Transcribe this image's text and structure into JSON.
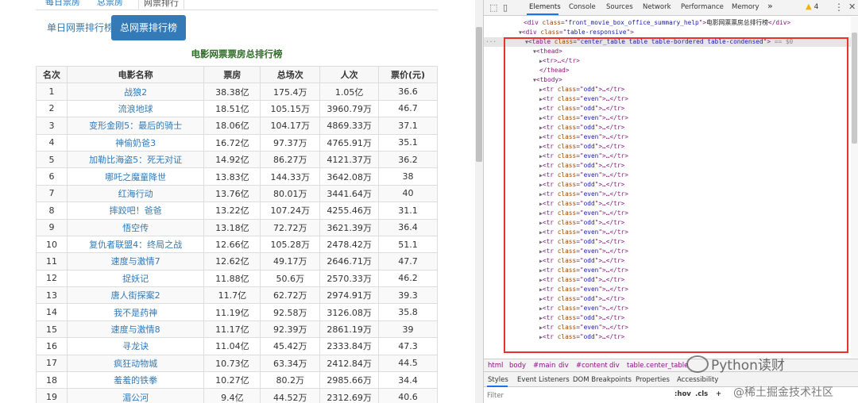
{
  "page": {
    "top_tabs": [
      "每日票房",
      "总票房",
      "网票排行"
    ],
    "sub_tabs": [
      {
        "label": "单日网票排行榜",
        "active": false
      },
      {
        "label": "总网票排行榜",
        "active": true
      }
    ],
    "table_title": "电影网票票房总排行榜",
    "columns": [
      "名次",
      "电影名称",
      "票房",
      "总场次",
      "人次",
      "票价(元)"
    ],
    "rows": [
      [
        "1",
        "战狼2",
        "38.38亿",
        "175.4万",
        "1.05亿",
        "36.6"
      ],
      [
        "2",
        "流浪地球",
        "18.51亿",
        "105.15万",
        "3960.79万",
        "46.7"
      ],
      [
        "3",
        "变形金刚5：最后的骑士",
        "18.06亿",
        "104.17万",
        "4869.33万",
        "37.1"
      ],
      [
        "4",
        "神偷奶爸3",
        "16.72亿",
        "97.37万",
        "4765.91万",
        "35.1"
      ],
      [
        "5",
        "加勒比海盗5：死无对证",
        "14.92亿",
        "86.27万",
        "4121.37万",
        "36.2"
      ],
      [
        "6",
        "哪吒之魔童降世",
        "13.83亿",
        "144.33万",
        "3642.08万",
        "38"
      ],
      [
        "7",
        "红海行动",
        "13.76亿",
        "80.01万",
        "3441.64万",
        "40"
      ],
      [
        "8",
        "摔跤吧！爸爸",
        "13.22亿",
        "107.24万",
        "4255.46万",
        "31.1"
      ],
      [
        "9",
        "悟空传",
        "13.18亿",
        "72.72万",
        "3621.39万",
        "36.4"
      ],
      [
        "10",
        "复仇者联盟4：终局之战",
        "12.66亿",
        "105.28万",
        "2478.42万",
        "51.1"
      ],
      [
        "11",
        "速度与激情7",
        "12.62亿",
        "49.17万",
        "2646.71万",
        "47.7"
      ],
      [
        "12",
        "捉妖记",
        "11.88亿",
        "50.6万",
        "2570.33万",
        "46.2"
      ],
      [
        "13",
        "唐人街探案2",
        "11.7亿",
        "62.72万",
        "2974.91万",
        "39.3"
      ],
      [
        "14",
        "我不是药神",
        "11.19亿",
        "92.58万",
        "3126.08万",
        "35.8"
      ],
      [
        "15",
        "速度与激情8",
        "11.17亿",
        "92.39万",
        "2861.19万",
        "39"
      ],
      [
        "16",
        "寻龙诀",
        "11.04亿",
        "45.42万",
        "2333.84万",
        "47.3"
      ],
      [
        "17",
        "疯狂动物城",
        "10.73亿",
        "63.34万",
        "2412.84万",
        "44.5"
      ],
      [
        "18",
        "羞羞的铁拳",
        "10.27亿",
        "80.2万",
        "2985.66万",
        "34.4"
      ],
      [
        "19",
        "湄公河",
        "9.4亿",
        "44.52万",
        "2312.69万",
        "40.6"
      ]
    ]
  },
  "devtools": {
    "tabs": [
      "Elements",
      "Console",
      "Sources",
      "Network",
      "Performance",
      "Memory"
    ],
    "more_tabs": "»",
    "warning_count": "4",
    "code": {
      "line0": "<div class=\"front_movie_box_office_summary_help\">电影网票票房总排行榜</div>",
      "line0_prefix": "<div class=\"",
      "line0_attr": "front_movie_box_office_summary_help",
      "line0_text": "\">电影网票票房总排行榜</div>",
      "line1": "<div class=\"table-responsive\">",
      "line1_attr": "table-responsive",
      "table_attr": "center_table table table-bordered table-condensed",
      "selected_suffix": "== $0",
      "thead_open": "<thead>",
      "tr_collapsed": "<tr>…</tr>",
      "thead_close": "</thead>",
      "tbody_open": "<tbody>",
      "row_classes": [
        "odd",
        "even",
        "odd",
        "even",
        "odd",
        "even",
        "odd",
        "even",
        "odd",
        "even",
        "odd",
        "even",
        "odd",
        "even",
        "odd",
        "even",
        "odd",
        "even",
        "odd",
        "even",
        "odd",
        "even",
        "odd",
        "even",
        "odd",
        "even",
        "odd"
      ]
    },
    "breadcrumbs": [
      "html",
      "body",
      "#main",
      "div",
      "#content",
      "div",
      "table.center_table"
    ],
    "styles_tabs": [
      "Styles",
      "Event Listeners",
      "DOM Breakpoints",
      "Properties",
      "Accessibility"
    ],
    "filter_placeholder": "Filter",
    "filter_buttons": [
      ":hov",
      ".cls",
      "+"
    ]
  },
  "watermarks": {
    "line1": "Python读财",
    "line2": "@稀土掘金技术社区"
  }
}
